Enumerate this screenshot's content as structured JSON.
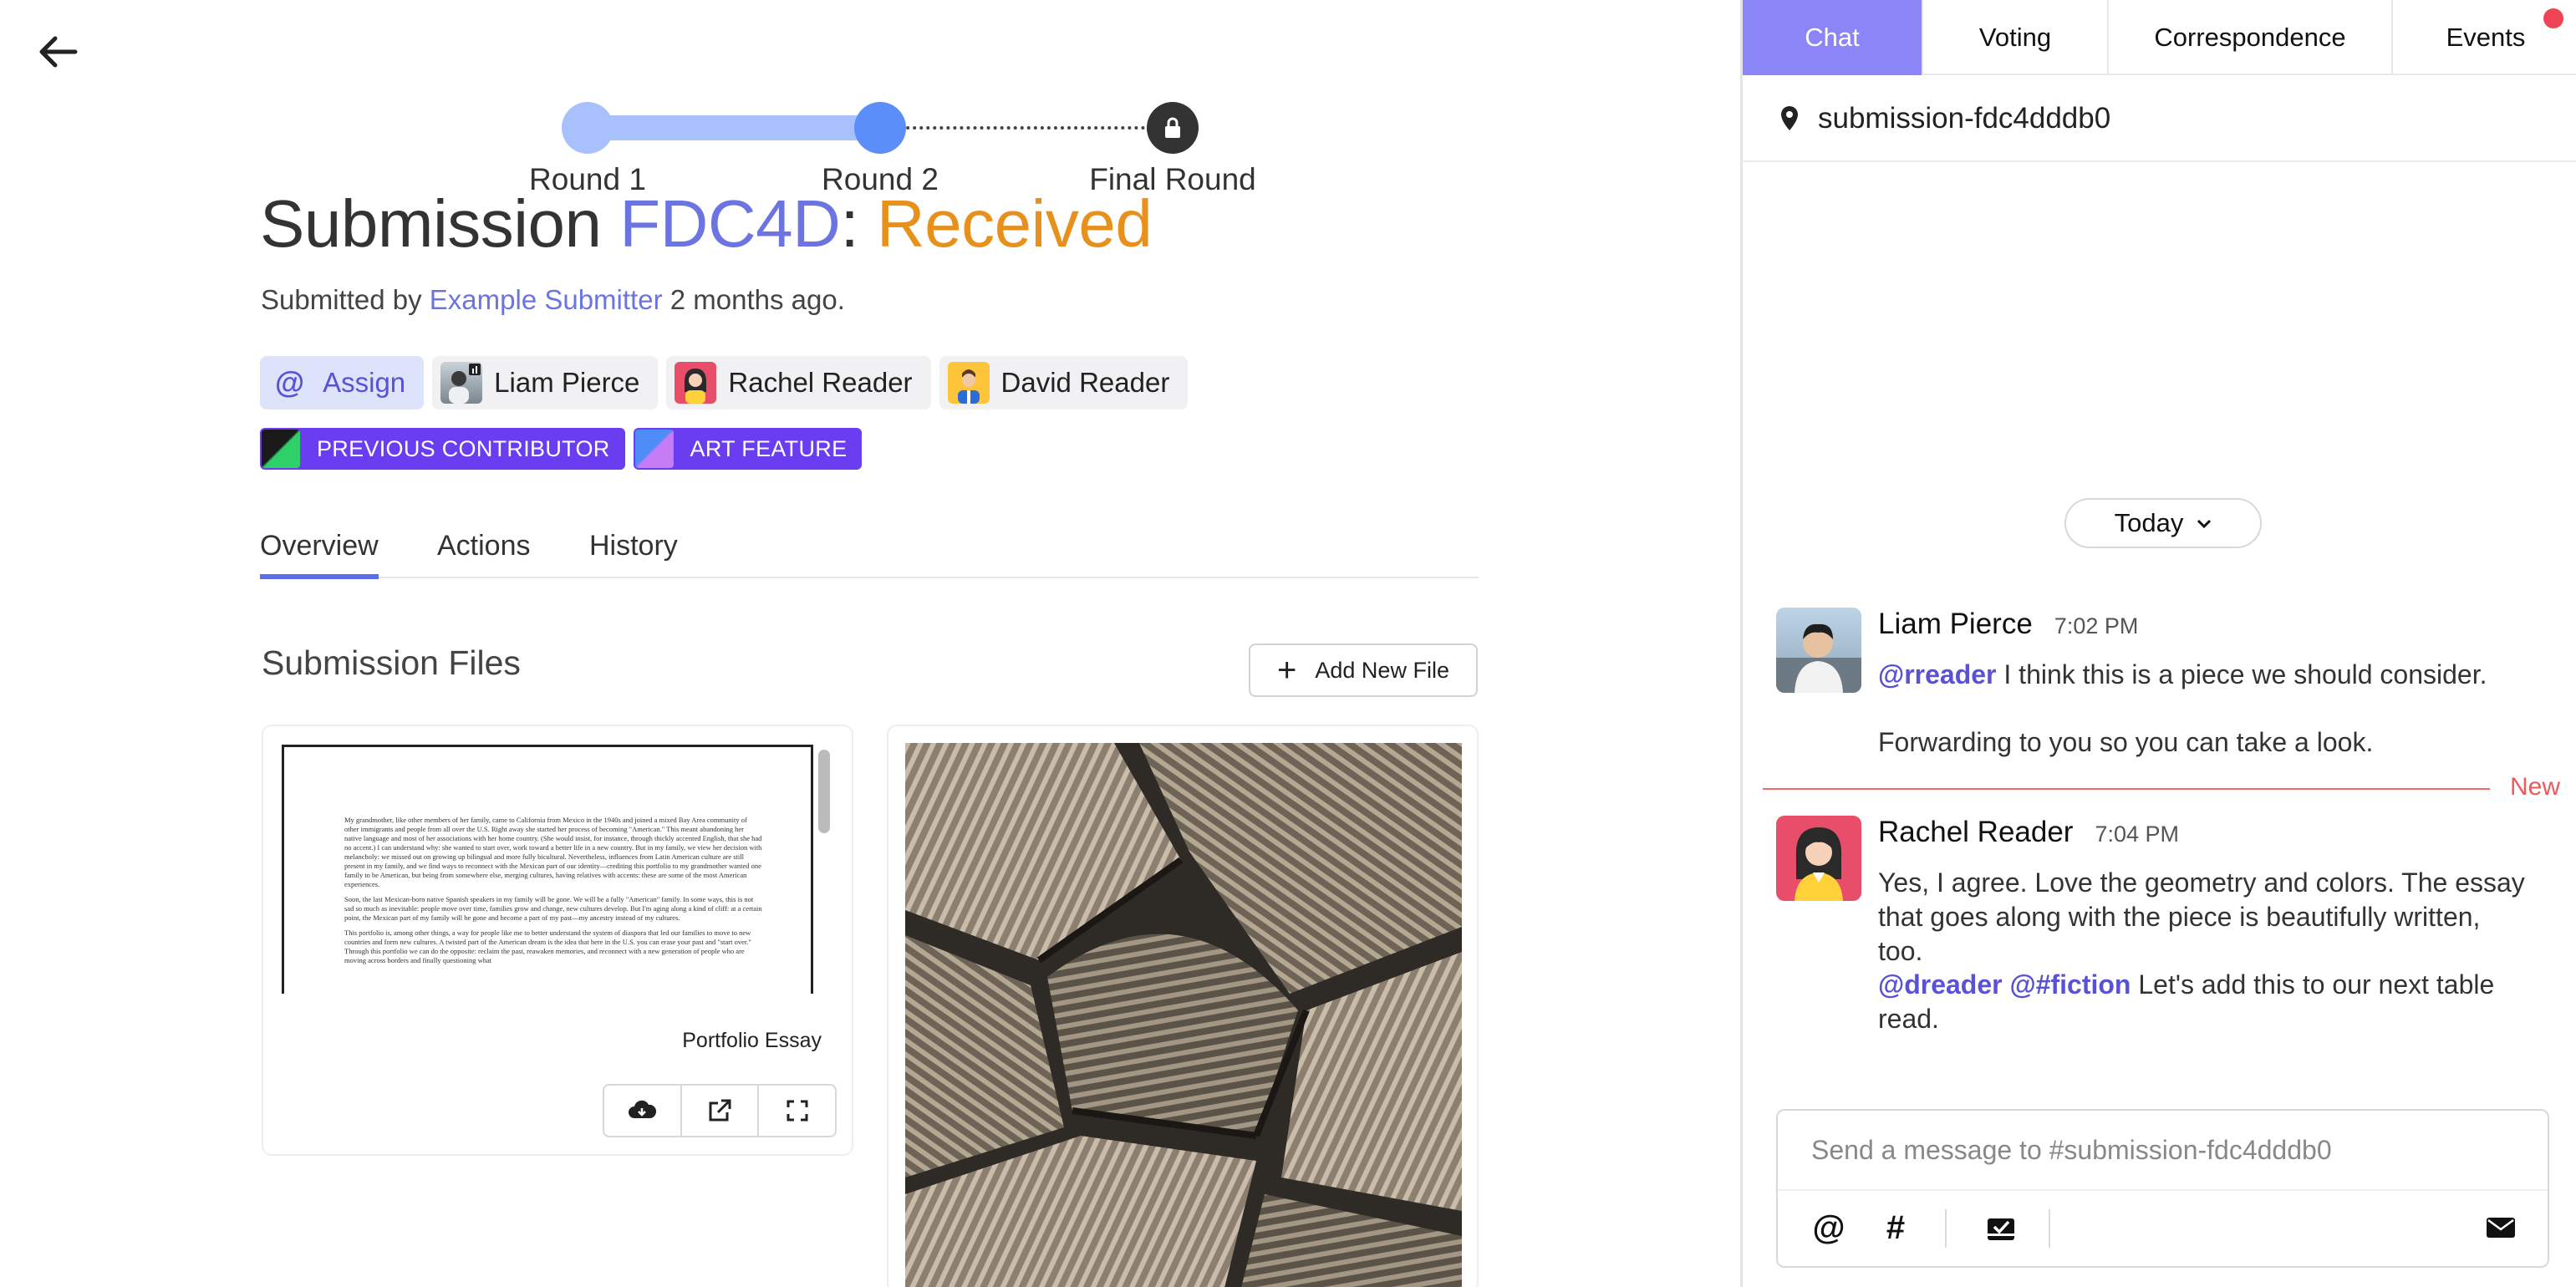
{
  "progress": {
    "steps": [
      {
        "label": "Round 1"
      },
      {
        "label": "Round 2"
      },
      {
        "label": "Final Round"
      }
    ]
  },
  "submission": {
    "title_prefix": "Submission ",
    "id": "FDC4D",
    "sep": ": ",
    "status": "Received",
    "submitted_by_prefix": "Submitted by ",
    "submitter": "Example Submitter",
    "submitted_ago": " 2 months ago."
  },
  "assignees": {
    "assign_label": "Assign",
    "assign_icon": "@",
    "people": [
      {
        "name": "Liam Pierce"
      },
      {
        "name": "Rachel Reader"
      },
      {
        "name": "David Reader"
      }
    ]
  },
  "tags": [
    {
      "label": "PREVIOUS CONTRIBUTOR"
    },
    {
      "label": "ART FEATURE"
    }
  ],
  "tabs": [
    {
      "label": "Overview"
    },
    {
      "label": "Actions"
    },
    {
      "label": "History"
    }
  ],
  "files": {
    "section_title": "Submission Files",
    "add_label": "Add New File",
    "add_icon": "+",
    "items": [
      {
        "name": "Portfolio Essay"
      }
    ],
    "essay_paragraphs": [
      "My grandmother, like other members of her family, came to California from Mexico in the 1940s and joined a mixed Bay Area community of other immigrants and people from all over the U.S. Right away she started her process of becoming \"American.\" This meant abandoning her native language and most of her associations with her home country. (She would insist, for instance, through thickly accented English, that she had no accent.) I can understand why: she wanted to start over, work toward a better life in a new country. But in my family, we view her decision with melancholy: we missed out on growing up bilingual and more fully bicultural. Nevertheless, influences from Latin American culture are still present in my family, and we find ways to reconnect with the Mexican part of our identity—crediting this portfolio to my grandmother wanted one family to be American, but being from somewhere else, merging cultures, having relatives with accents: these are some of the most American experiences.",
      "Soon, the last Mexican-born native Spanish speakers in my family will be gone. We will be a fully \"American\" family. In some ways, this is not sad so much as inevitable: people move over time, families grow and change, new cultures develop. But I'm aging along a kind of cliff: at a certain point, the Mexican part of my family will be gone and become a part of my past—my ancestry instead of my cultures.",
      "This portfolio is, among other things, a way for people like me to better understand the system of diaspora that led our families to move to new countries and form new cultures. A twisted part of the American dream is the idea that here in the U.S. you can erase your past and \"start over.\" Through this portfolio we can do the opposite: reclaim the past, reawaken memories, and reconnect with a new generation of people who are moving across borders and finally questioning what"
    ]
  },
  "chat": {
    "tabs": [
      {
        "label": "Chat"
      },
      {
        "label": "Voting"
      },
      {
        "label": "Correspondence"
      },
      {
        "label": "Events"
      }
    ],
    "channel": "submission-fdc4dddb0",
    "day_label": "Today",
    "new_label": "New",
    "messages": [
      {
        "author": "Liam Pierce",
        "time": "7:02 PM",
        "line1_mention": "@rreader",
        "line1_text": " I think this is a piece we should consider.",
        "line2_text": "Forwarding to you so you can take a look."
      },
      {
        "author": "Rachel Reader",
        "time": "7:04 PM",
        "line1_text": "Yes, I agree. Love the geometry and colors. The essay that goes along with the piece is beautifully written, too.",
        "line2_mention1": "@dreader",
        "line2_mention2": "@#fiction",
        "line2_text": " Let's add this to our next table read."
      }
    ],
    "composer_placeholder": "Send a message to #submission-fdc4dddb0",
    "composer_tools": {
      "mention": "@",
      "hashtag": "#"
    }
  },
  "colors": {
    "accent": "#6b74e0",
    "status": "#e8901c",
    "tag_bg": "#6a3df0",
    "chat_tab_active": "#8b85f7",
    "new_divider": "#ee6b6b"
  }
}
